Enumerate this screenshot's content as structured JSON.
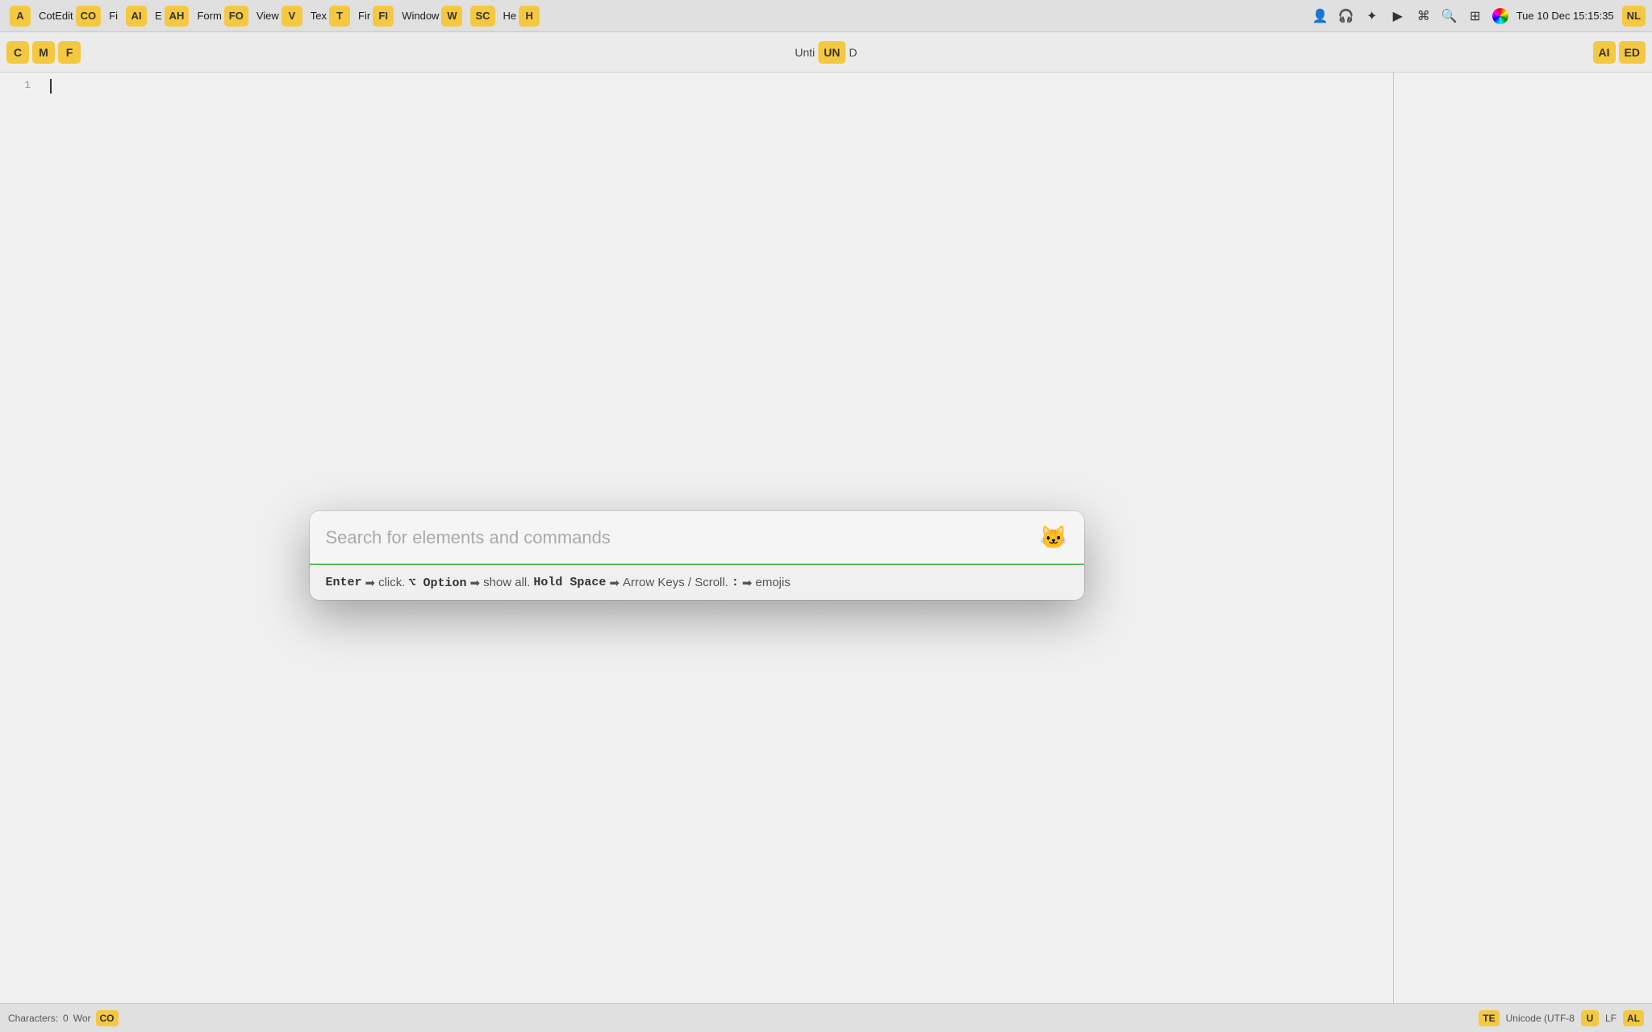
{
  "menubar": {
    "app_icon": "A",
    "items": [
      {
        "label": "CotEdit",
        "badge": "CO"
      },
      {
        "label": "Fi",
        "badge": null
      },
      {
        "label": "AI",
        "badge": "AI"
      },
      {
        "label": "E",
        "badge": null
      },
      {
        "label": "AH",
        "badge": "AH"
      },
      {
        "label": "Form",
        "badge": null
      },
      {
        "label": "FO",
        "badge": "FO"
      },
      {
        "label": "View",
        "badge": null
      },
      {
        "label": "V",
        "badge": "V"
      },
      {
        "label": "Tex",
        "badge": null
      },
      {
        "label": "T",
        "badge": "T"
      },
      {
        "label": "Fir",
        "badge": null
      },
      {
        "label": "FI",
        "badge": "FI"
      },
      {
        "label": "Window",
        "badge": null
      },
      {
        "label": "W",
        "badge": "W"
      },
      {
        "label": "SC",
        "badge": "SC"
      },
      {
        "label": "He",
        "badge": null
      },
      {
        "label": "H",
        "badge": "H"
      }
    ],
    "time": "Tue 10 Dec  15:15:35"
  },
  "toolbar": {
    "items": [
      {
        "label": "C",
        "badge": "C"
      },
      {
        "label": "M",
        "badge": "M"
      },
      {
        "label": "F",
        "badge": "F"
      }
    ],
    "title": "Untitled",
    "title_badge": "UN",
    "title_suffix": "D",
    "right_badge1": "AI",
    "right_badge2": "ED"
  },
  "editor": {
    "line_numbers": [
      "1"
    ],
    "content": ""
  },
  "quick_open": {
    "placeholder": "Search for elements and commands",
    "hint": "Enter ➡ click. ⌥ Option ➡ show all. Hold Space ➡ Arrow Keys / Scroll. : ➡ emojis",
    "hint_parts": [
      {
        "text": "Enter",
        "type": "key"
      },
      {
        "text": "➡",
        "type": "arrow"
      },
      {
        "text": "click.",
        "type": "normal"
      },
      {
        "text": "⌥ Option",
        "type": "key"
      },
      {
        "text": "➡",
        "type": "arrow"
      },
      {
        "text": "show all.",
        "type": "normal"
      },
      {
        "text": "Hold Space",
        "type": "key"
      },
      {
        "text": "➡",
        "type": "arrow"
      },
      {
        "text": "Arrow Keys / Scroll.",
        "type": "normal"
      },
      {
        "text": ":",
        "type": "key"
      },
      {
        "text": "➡",
        "type": "arrow"
      },
      {
        "text": "emojis",
        "type": "normal"
      }
    ],
    "cat_icon": "🐱"
  },
  "statusbar": {
    "characters_label": "Characters:",
    "characters_value": "0",
    "words_label": "Wor",
    "words_badge": "CO",
    "right": {
      "te_badge": "TE",
      "encoding": "Unicode (UTF-8",
      "encoding_badge": "U",
      "line_ending": "LF",
      "al_badge": "AL"
    }
  }
}
